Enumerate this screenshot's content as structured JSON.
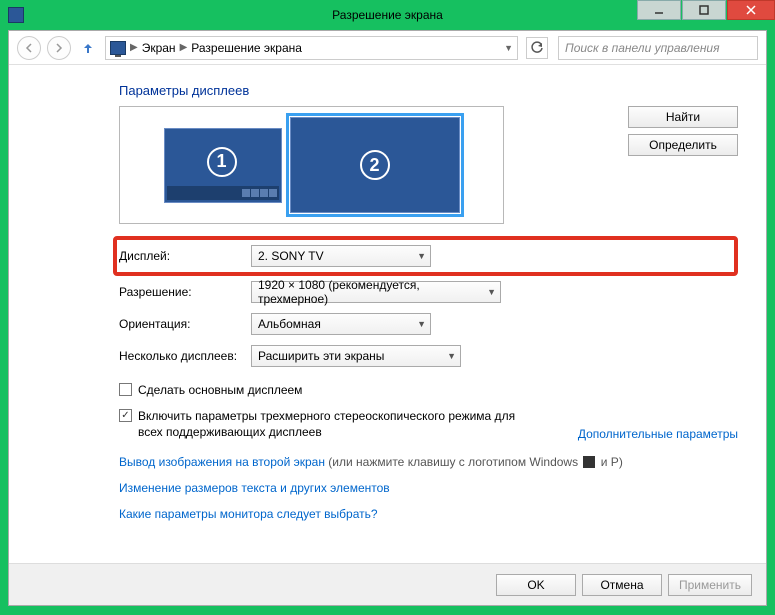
{
  "window": {
    "title": "Разрешение экрана"
  },
  "breadcrumb": {
    "item1": "Экран",
    "item2": "Разрешение экрана"
  },
  "search": {
    "placeholder": "Поиск в панели управления"
  },
  "section": {
    "title": "Параметры дисплеев"
  },
  "monitors": {
    "m1": "1",
    "m2": "2"
  },
  "side_buttons": {
    "find": "Найти",
    "identify": "Определить"
  },
  "form": {
    "display_label": "Дисплей:",
    "display_value": "2. SONY TV",
    "resolution_label": "Разрешение:",
    "resolution_value": "1920 × 1080 (рекомендуется, трехмерное)",
    "orientation_label": "Ориентация:",
    "orientation_value": "Альбомная",
    "multi_label": "Несколько дисплеев:",
    "multi_value": "Расширить эти экраны"
  },
  "checkboxes": {
    "make_primary": "Сделать основным дисплеем",
    "stereo": "Включить параметры трехмерного стереоскопического режима для всех поддерживающих дисплеев"
  },
  "adv_link": "Дополнительные параметры",
  "links": {
    "project_prefix": "Вывод изображения на второй экран",
    "project_suffix": " (или нажмите клавишу с логотипом Windows ",
    "project_tail": " и P)",
    "text_size": "Изменение размеров текста и других элементов",
    "which": "Какие параметры монитора следует выбрать?"
  },
  "footer": {
    "ok": "OK",
    "cancel": "Отмена",
    "apply": "Применить"
  }
}
